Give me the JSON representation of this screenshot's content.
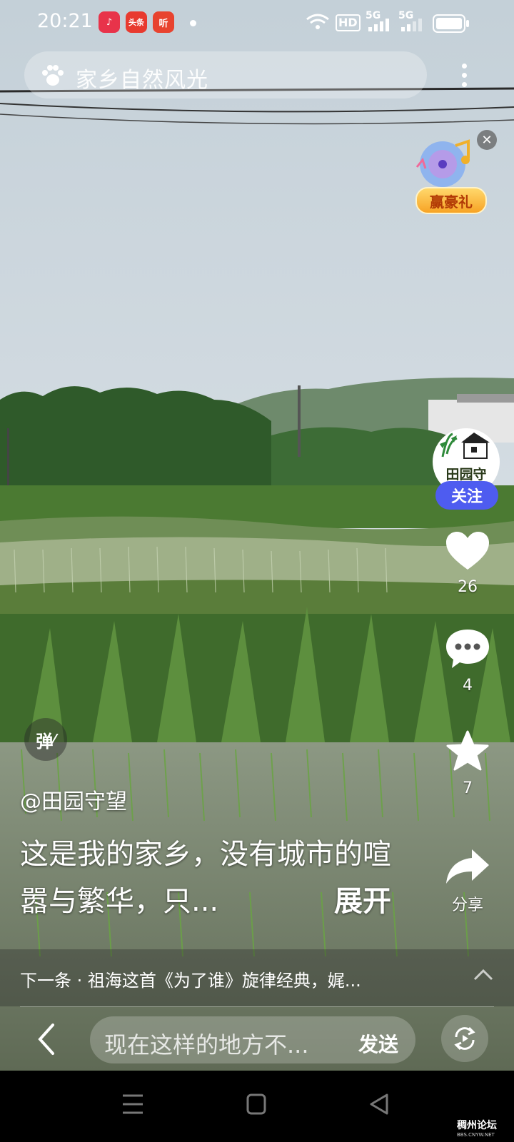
{
  "status_bar": {
    "time": "20:21",
    "apps": [
      {
        "icon": "music-app-icon",
        "text": "♪",
        "color": "#e8334a"
      },
      {
        "icon": "toutiao-app-icon",
        "text": "头条",
        "color": "#e83a2f"
      },
      {
        "icon": "listen-app-icon",
        "text": "听",
        "color": "#e8432f"
      }
    ],
    "hd_label": "HD",
    "network_1": "5G",
    "network_2": "5G"
  },
  "search": {
    "query": "家乡自然风光"
  },
  "promo": {
    "label": "赢豪礼"
  },
  "creator": {
    "avatar_text": "田园守",
    "follow_label": "关注"
  },
  "actions": {
    "like_count": "26",
    "comment_count": "4",
    "favorite_count": "7",
    "share_label": "分享"
  },
  "danmu_label": "弹",
  "caption": {
    "author": "@田园守望",
    "text": "这是我的家乡，没有城市的喧嚣与繁华，只...",
    "expand_label": "展开"
  },
  "next_up": {
    "text": "下一条 · 祖海这首《为了谁》旋律经典，娓..."
  },
  "comment_bar": {
    "placeholder": "现在这样的地方不...",
    "send_label": "发送"
  },
  "watermark": {
    "title": "稠州论坛",
    "sub": "BBS.CNYW.NET"
  },
  "colors": {
    "follow": "#4e5cf0",
    "promo": "#f7a325"
  }
}
